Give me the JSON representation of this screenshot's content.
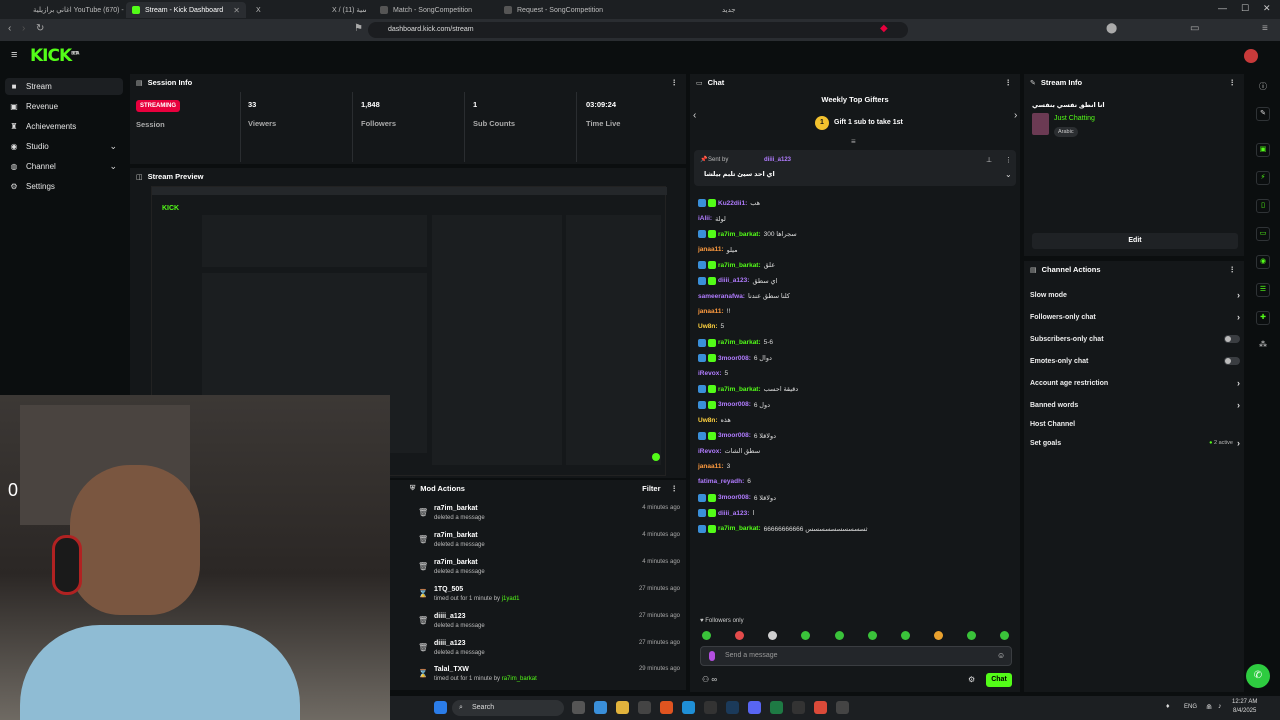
{
  "browser": {
    "tabs": [
      {
        "label": "اغاني برازيلية YouTube (670) -"
      },
      {
        "label": "Stream - Kick Dashboard"
      },
      {
        "label": "X"
      },
      {
        "label": "X / الرئيسية (11)"
      },
      {
        "label": "Match - SongCompetition"
      },
      {
        "label": "Request - SongCompetition"
      },
      {
        "label": "جديد"
      }
    ],
    "url": "dashboard.kick.com/stream"
  },
  "app": {
    "logo": "KICK",
    "logo_sup": "BETA"
  },
  "sidebar": {
    "items": [
      {
        "label": "Stream",
        "icon": "video-icon"
      },
      {
        "label": "Revenue",
        "icon": "revenue-icon"
      },
      {
        "label": "Achievements",
        "icon": "trophy-icon"
      },
      {
        "label": "Studio",
        "icon": "studio-icon"
      },
      {
        "label": "Channel",
        "icon": "channel-icon"
      },
      {
        "label": "Settings",
        "icon": "gear-icon"
      }
    ]
  },
  "session": {
    "title": "Session Info",
    "badge": "STREAMING",
    "session_label": "Session",
    "stats": [
      {
        "value": "33",
        "label": "Viewers"
      },
      {
        "value": "1,848",
        "label": "Followers"
      },
      {
        "value": "1",
        "label": "Sub Counts"
      },
      {
        "value": "03:09:24",
        "label": "Time Live"
      }
    ]
  },
  "preview": {
    "title": "Stream Preview"
  },
  "mod": {
    "title": "Mod Actions",
    "filter": "Filter",
    "rows": [
      {
        "user": "ra7im_barkat",
        "action": "deleted a message",
        "by": "",
        "time": "4 minutes ago",
        "icon": "trash-icon"
      },
      {
        "user": "ra7im_barkat",
        "action": "deleted a message",
        "by": "",
        "time": "4 minutes ago",
        "icon": "trash-icon"
      },
      {
        "user": "ra7im_barkat",
        "action": "deleted a message",
        "by": "",
        "time": "4 minutes ago",
        "icon": "trash-icon"
      },
      {
        "user": "1TQ_505",
        "action": "timed out for 1 minute by",
        "by": "j1yad1",
        "time": "27 minutes ago",
        "icon": "hourglass-icon"
      },
      {
        "user": "diiii_a123",
        "action": "deleted a message",
        "by": "",
        "time": "27 minutes ago",
        "icon": "trash-icon"
      },
      {
        "user": "diiii_a123",
        "action": "deleted a message",
        "by": "",
        "time": "27 minutes ago",
        "icon": "trash-icon"
      },
      {
        "user": "Talal_TXW",
        "action": "timed out for 1 minute by",
        "by": "ra7im_barkat",
        "time": "29 minutes ago",
        "icon": "hourglass-icon"
      }
    ]
  },
  "chat": {
    "title": "Chat",
    "top_gifters": "Weekly Top Gifters",
    "gift_cta": "Gift 1 sub to take 1st",
    "pinned_by_label": "Sent by",
    "pinned_user": "diiii_a123",
    "pinned_text": "اي احد سيئ تلبم بيلشا",
    "messages": [
      {
        "user": "Ku22dii1:",
        "text": "هب",
        "color": "#b17cff"
      },
      {
        "user": "iAlii:",
        "text": "لولة",
        "color": "#b17cff"
      },
      {
        "user": "ra7im_barkat:",
        "text": "300 سجراها",
        "color": "#53fc18"
      },
      {
        "user": "janaa11:",
        "text": "ميلو",
        "color": "#ff9b3f"
      },
      {
        "user": "ra7im_barkat:",
        "text": "علق",
        "color": "#53fc18"
      },
      {
        "user": "diiii_a123:",
        "text": "اي سطق",
        "color": "#b17cff"
      },
      {
        "user": "sameeranafwa:",
        "text": "كلنا سطق عندنا",
        "color": "#b17cff"
      },
      {
        "user": "janaa11:",
        "text": "!!",
        "color": "#ff9b3f"
      },
      {
        "user": "Uw8n:",
        "text": "5",
        "color": "#ffd23f"
      },
      {
        "user": "ra7im_barkat:",
        "text": "5-6",
        "color": "#53fc18"
      },
      {
        "user": "3moor008:",
        "text": "6 دوال",
        "color": "#b17cff"
      },
      {
        "user": "iRevox:",
        "text": "5",
        "color": "#b17cff"
      },
      {
        "user": "ra7im_barkat:",
        "text": "دقيقة احسب",
        "color": "#53fc18"
      },
      {
        "user": "3moor008:",
        "text": "6 دول",
        "color": "#b17cff"
      },
      {
        "user": "Uw8n:",
        "text": "هذه",
        "color": "#ffd23f"
      },
      {
        "user": "3moor008:",
        "text": "6 دولاقلا",
        "color": "#b17cff"
      },
      {
        "user": "iRevox:",
        "text": "سطق الشات",
        "color": "#b17cff"
      },
      {
        "user": "janaa11:",
        "text": "3",
        "color": "#ff9b3f"
      },
      {
        "user": "fatima_reyadh:",
        "text": "6",
        "color": "#b17cff"
      },
      {
        "user": "3moor008:",
        "text": "6 دولاقلا",
        "color": "#b17cff"
      },
      {
        "user": "diiii_a123:",
        "text": "ا",
        "color": "#b17cff"
      },
      {
        "user": "ra7im_barkat:",
        "text": "66666666666 ثسسسسسسسسسس",
        "color": "#53fc18"
      }
    ],
    "followers_only": "Followers only",
    "placeholder": "Send a message",
    "send": "Chat"
  },
  "stream_info": {
    "title": "Stream Info",
    "stream_title": "انا انطق نفسي بنفسي",
    "category": "Just Chatting",
    "language": "Arabic",
    "edit": "Edit"
  },
  "channel_actions": {
    "title": "Channel Actions",
    "rows": [
      {
        "label": "Slow mode",
        "kind": "arrow"
      },
      {
        "label": "Followers-only chat",
        "kind": "arrow"
      },
      {
        "label": "Subscribers-only chat",
        "kind": "toggle"
      },
      {
        "label": "Emotes-only chat",
        "kind": "toggle"
      },
      {
        "label": "Account age restriction",
        "kind": "arrow"
      },
      {
        "label": "Banned words",
        "kind": "arrow"
      },
      {
        "label": "Host Channel",
        "kind": "none"
      },
      {
        "label": "Set goals",
        "kind": "arrow",
        "extra": "2 active"
      }
    ]
  },
  "taskbar": {
    "search": "Search",
    "lang": "ENG",
    "time": "12:27 AM",
    "date": "8/4/2025"
  },
  "colors": {
    "accent": "#53fc18",
    "live": "#e8003d",
    "panel": "#141719"
  }
}
